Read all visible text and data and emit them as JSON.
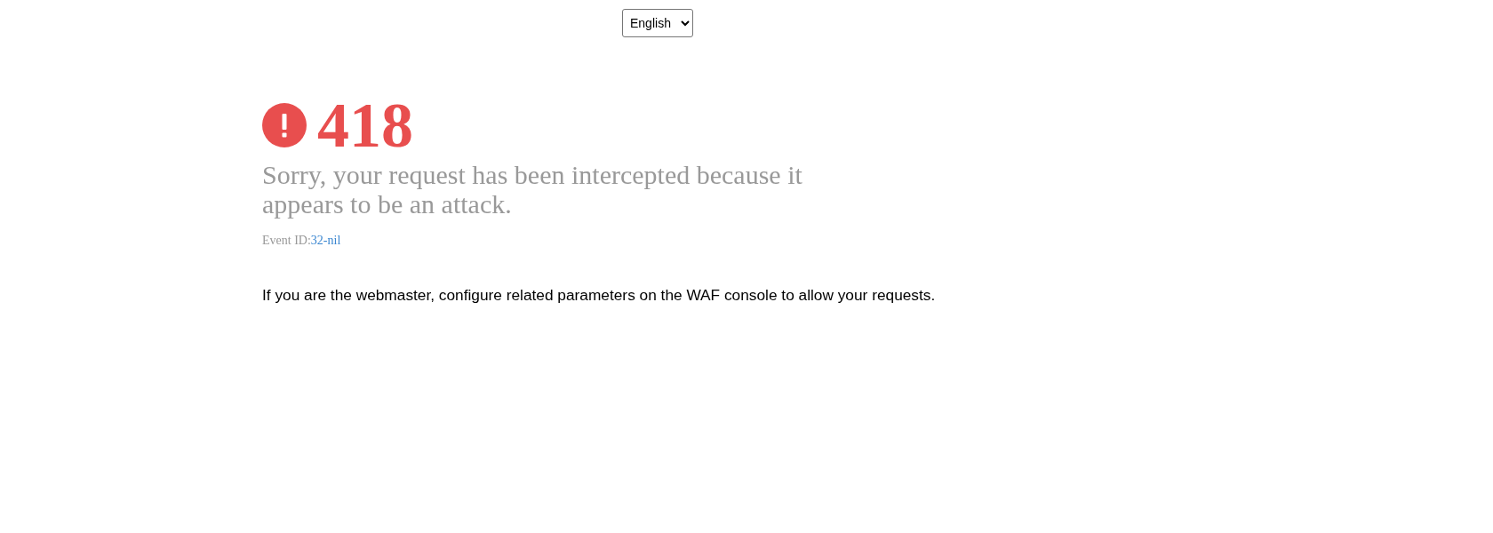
{
  "language_select": {
    "value": "English"
  },
  "error": {
    "code": "418",
    "message": "Sorry, your request has been intercepted because it appears to be an attack.",
    "event_id_label": "Event ID:",
    "event_id": "32-nil"
  },
  "note": "If you are the webmaster, configure related parameters on the WAF console to allow your requests."
}
